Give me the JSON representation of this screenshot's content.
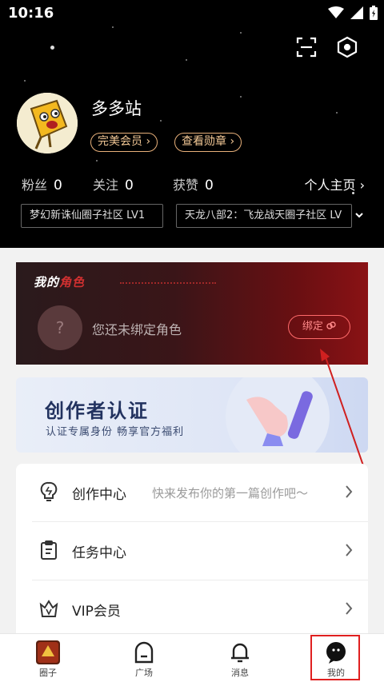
{
  "status_bar": {
    "time": "10:16"
  },
  "profile": {
    "nickname": "多多站",
    "tags": [
      "完美会员 ›",
      "查看勋章 ›"
    ],
    "stats": [
      {
        "label": "粉丝",
        "value": "0"
      },
      {
        "label": "关注",
        "value": "0"
      },
      {
        "label": "获赞",
        "value": "0"
      }
    ],
    "homepage_link": "个人主页 ›",
    "communities": [
      "梦幻新诛仙圈子社区 LV1",
      "天龙八部2：飞龙战天圈子社区 LV"
    ]
  },
  "role_card": {
    "title_a": "我的",
    "title_b": "角色",
    "placeholder": "?",
    "text": "您还未绑定角色",
    "bind_label": "绑定"
  },
  "creator_banner": {
    "title": "创作者认证",
    "subtitle": "认证专属身份  畅享官方福利"
  },
  "menu": [
    {
      "label": "创作中心",
      "desc": "快来发布你的第一篇创作吧～",
      "icon": "lightbulb-icon"
    },
    {
      "label": "任务中心",
      "desc": "",
      "icon": "clipboard-icon"
    },
    {
      "label": "VIP会员",
      "desc": "",
      "icon": "vip-crown-icon"
    }
  ],
  "tabs": [
    {
      "label": "圈子",
      "icon": "game-thumbnail-icon"
    },
    {
      "label": "广场",
      "icon": "plaza-icon"
    },
    {
      "label": "消息",
      "icon": "bell-icon"
    },
    {
      "label": "我的",
      "icon": "chat-bubble-icon"
    }
  ],
  "colors": {
    "accent_red": "#e02020",
    "gold": "#e8b07a"
  }
}
